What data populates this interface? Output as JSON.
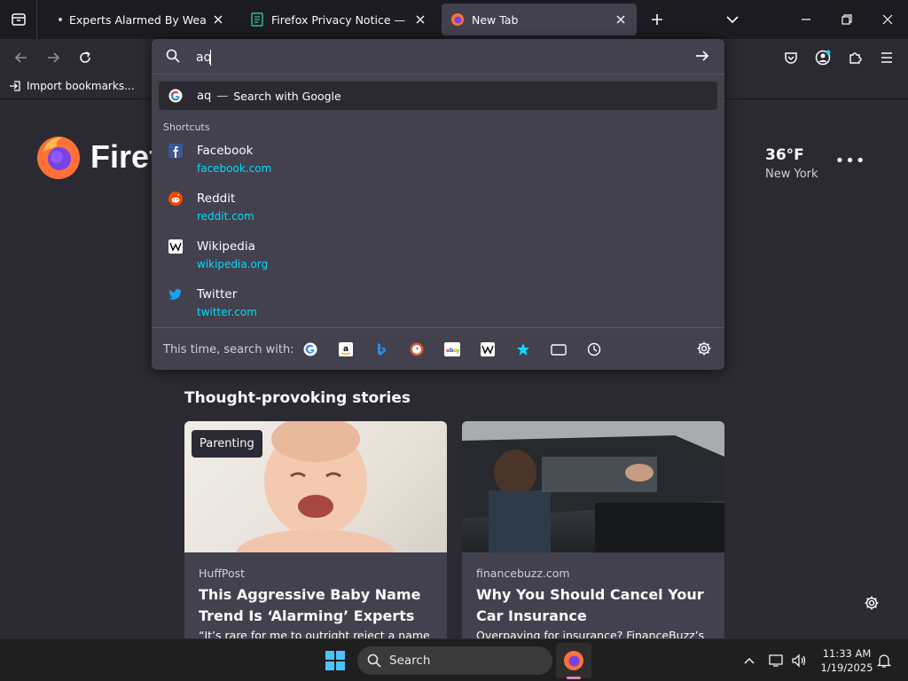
{
  "tabs": [
    {
      "title": "Experts Alarmed By Weapon Ban",
      "active": false
    },
    {
      "title": "Firefox Privacy Notice — Mozilla",
      "active": false
    },
    {
      "title": "New Tab",
      "active": true
    }
  ],
  "urlbar": {
    "value": "aq",
    "suggestion": {
      "term": "aq",
      "separator": "—",
      "action": "Search with Google"
    },
    "shortcuts_label": "Shortcuts",
    "shortcuts": [
      {
        "name": "Facebook",
        "url": "facebook.com",
        "icon": "facebook-icon"
      },
      {
        "name": "Reddit",
        "url": "reddit.com",
        "icon": "reddit-icon"
      },
      {
        "name": "Wikipedia",
        "url": "wikipedia.org",
        "icon": "wikipedia-icon"
      },
      {
        "name": "Twitter",
        "url": "twitter.com",
        "icon": "twitter-icon"
      }
    ],
    "engines_label": "This time, search with:",
    "engines": [
      "google-icon",
      "amazon-icon",
      "bing-icon",
      "duckduckgo-icon",
      "ebay-icon",
      "wikipedia-icon",
      "bookmarks-star-icon",
      "tabs-icon",
      "history-clock-icon"
    ]
  },
  "bookmarks": {
    "import_label": "Import bookmarks..."
  },
  "newtab": {
    "logo_text": "Firefox",
    "weather": {
      "temp": "36°F",
      "city": "New York"
    },
    "stories_title": "Thought-provoking stories",
    "cards": [
      {
        "badge": "Parenting",
        "source": "HuffPost",
        "headline": "This Aggressive Baby Name Trend Is ‘Alarming’ Experts",
        "excerpt": "“It’s rare for me to outright reject a name"
      },
      {
        "badge": "",
        "source": "financebuzz.com",
        "headline": "Why You Should Cancel Your Car Insurance",
        "excerpt": "Overpaying for insurance? FinanceBuzz’s"
      }
    ]
  },
  "taskbar": {
    "search_label": "Search",
    "time": "11:33 AM",
    "date": "1/19/2025"
  },
  "colors": {
    "accent_link": "#00ddff",
    "panel": "#42414d",
    "background": "#2b2a33"
  }
}
